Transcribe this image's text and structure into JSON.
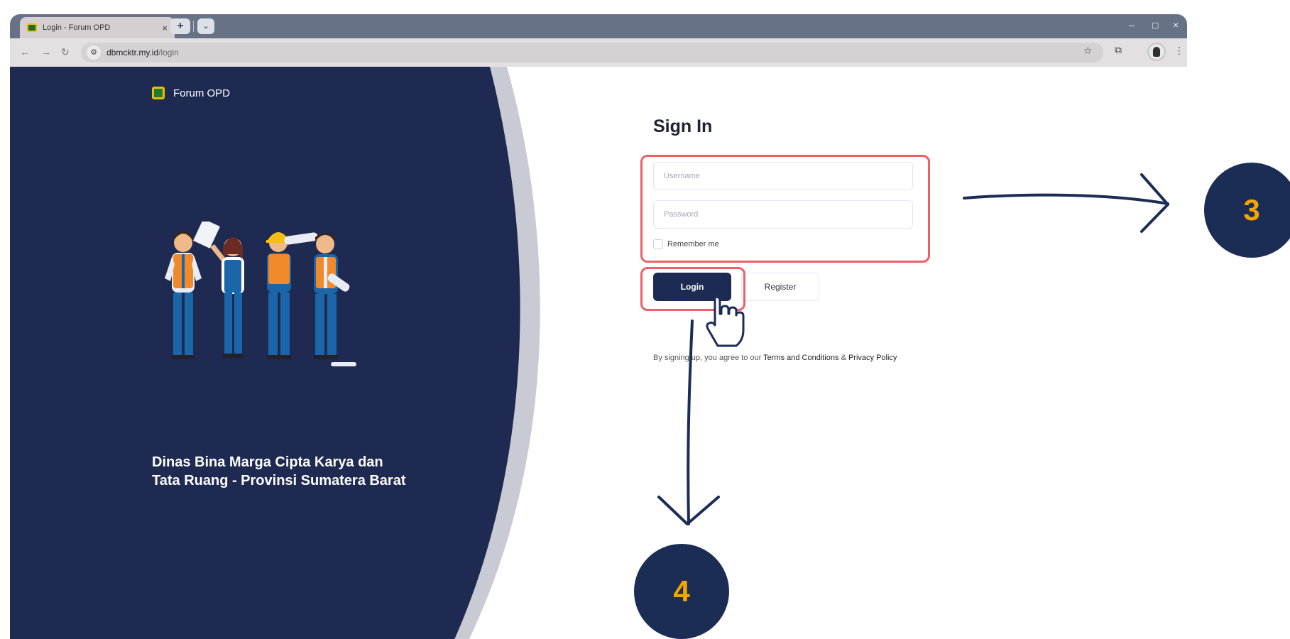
{
  "browser": {
    "tab_title": "Login - Forum OPD",
    "tab_close": "×",
    "new_tab": "+",
    "tab_search": "⌄",
    "url_host": "dbmcktr.my.id",
    "url_path": "/login",
    "window_controls": {
      "minimize": "–",
      "restore": "▢",
      "close": "×"
    },
    "nav": {
      "back": "←",
      "forward": "→",
      "reload": "↻"
    },
    "star": "☆",
    "extensions": "⧉",
    "menu": "⋮"
  },
  "left_panel": {
    "brand_name": "Forum OPD",
    "tagline_line1": "Dinas Bina Marga Cipta Karya dan",
    "tagline_line2": "Tata Ruang - Provinsi Sumatera Barat"
  },
  "signin": {
    "title": "Sign In",
    "username_placeholder": "Username",
    "password_placeholder": "Password",
    "remember_label": "Remember me",
    "login_label": "Login",
    "register_label": "Register",
    "terms_prefix": "By signing up, you agree to our ",
    "terms_link": "Terms and Conditions",
    "terms_and": " & ",
    "privacy_link": "Privacy Policy"
  },
  "annotations": {
    "step_3": "3",
    "step_4": "4"
  },
  "colors": {
    "panel_navy": "#1e2a52",
    "button_navy": "#1d2b54",
    "highlight_red": "#ee5f66",
    "badge_orange": "#f6a400",
    "tabbar": "#687287"
  }
}
